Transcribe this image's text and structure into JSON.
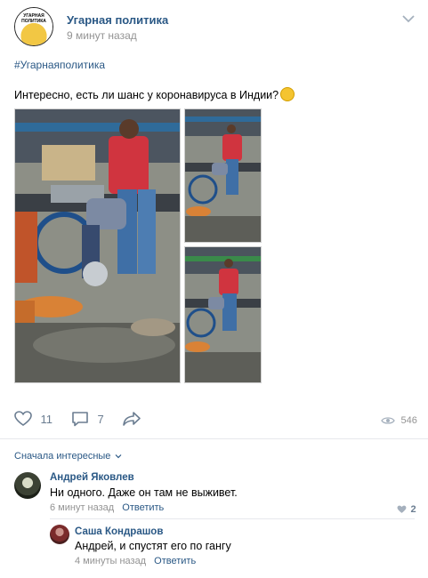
{
  "post": {
    "author": "Угарная политика",
    "time": "9 минут назад",
    "avatar_text": "УГАРНАЯ ПОЛИТИКА",
    "hashtag": "#Угарнаяполитика",
    "text": "Интересно, есть ли шанс у коронавируса в Индии?",
    "emoji": "thinking-face-icon"
  },
  "actions": {
    "likes": "11",
    "comments": "7",
    "views": "546"
  },
  "comments_section": {
    "sort_label": "Сначала интересные",
    "comments": [
      {
        "author": "Андрей Яковлев",
        "text": "Ни одного. Даже он там не выживет.",
        "time": "6 минут назад",
        "reply_label": "Ответить",
        "likes": "2"
      },
      {
        "author": "Саша Кондрашов",
        "text": "Андрей, и спустят его по гангу",
        "time": "4 минуты назад",
        "reply_label": "Ответить"
      }
    ]
  },
  "colors": {
    "link": "#2a5885",
    "muted": "#939393",
    "icon": "#6b7d91"
  }
}
